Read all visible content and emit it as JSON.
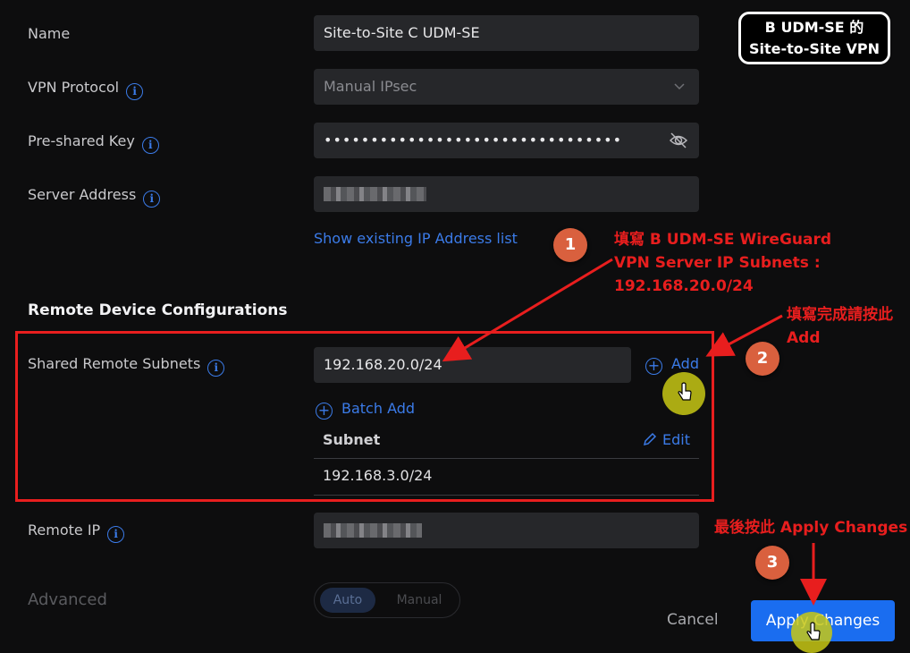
{
  "form": {
    "name_label": "Name",
    "name_value": "Site-to-Site C UDM-SE",
    "protocol_label": "VPN Protocol",
    "protocol_value": "Manual IPsec",
    "psk_label": "Pre-shared Key",
    "psk_value": "••••••••••••••••••••••••••••••••",
    "server_label": "Server Address",
    "show_ip_link": "Show existing IP Address list",
    "remote_section_title": "Remote Device Configurations",
    "shared_subnets_label": "Shared Remote Subnets",
    "subnet_input_value": "192.168.20.0/24",
    "add_label": "Add",
    "batch_add_label": "Batch Add",
    "subnet_col_header": "Subnet",
    "edit_label": "Edit",
    "subnets": [
      "192.168.3.0/24"
    ],
    "remote_ip_label": "Remote IP",
    "advanced_label": "Advanced",
    "advanced_options": [
      "Auto",
      "Manual"
    ],
    "advanced_selected": "Auto",
    "cancel_label": "Cancel",
    "apply_label": "Apply Changes"
  },
  "annotations": {
    "title_line1": "B UDM-SE 的",
    "title_line2": "Site-to-Site VPN",
    "step1_number": "1",
    "step1_text_line1": "填寫 B UDM-SE WireGuard",
    "step1_text_line2": "VPN Server IP Subnets :",
    "step1_text_line3": "192.168.20.0/24",
    "step2_number": "2",
    "step2_text_line1": "填寫完成請按此",
    "step2_text_line2": "Add",
    "step3_number": "3",
    "step3_text": "最後按此 Apply Changes"
  },
  "colors": {
    "accent_blue": "#3b7be8",
    "annotation_red": "#e81e1e",
    "badge_orange": "#d9603e",
    "apply_button": "#1a6df0"
  }
}
